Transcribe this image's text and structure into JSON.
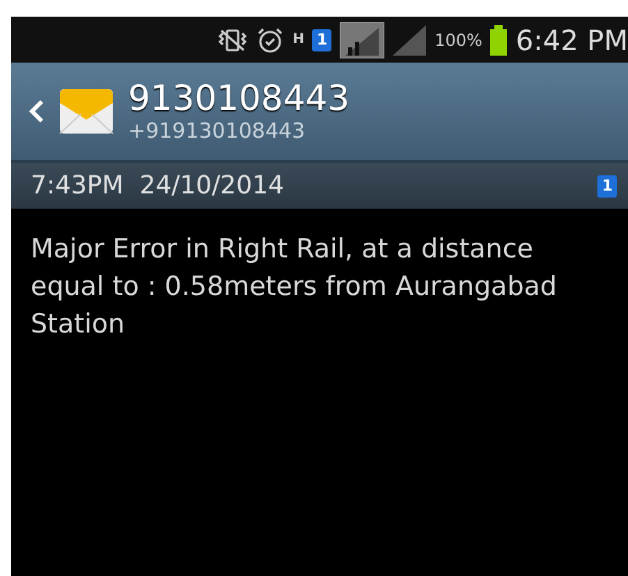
{
  "status_bar": {
    "network_type": "H",
    "sim_badge": "1",
    "battery": "100%",
    "time": "6:42 PM"
  },
  "header": {
    "name": "9130108443",
    "number": "+919130108443"
  },
  "message": {
    "timestamp": "7:43PM  24/10/2014",
    "sim_badge": "1",
    "text": "Major Error in Right Rail, at a distance equal to : 0.58meters from Aurangabad Station"
  }
}
